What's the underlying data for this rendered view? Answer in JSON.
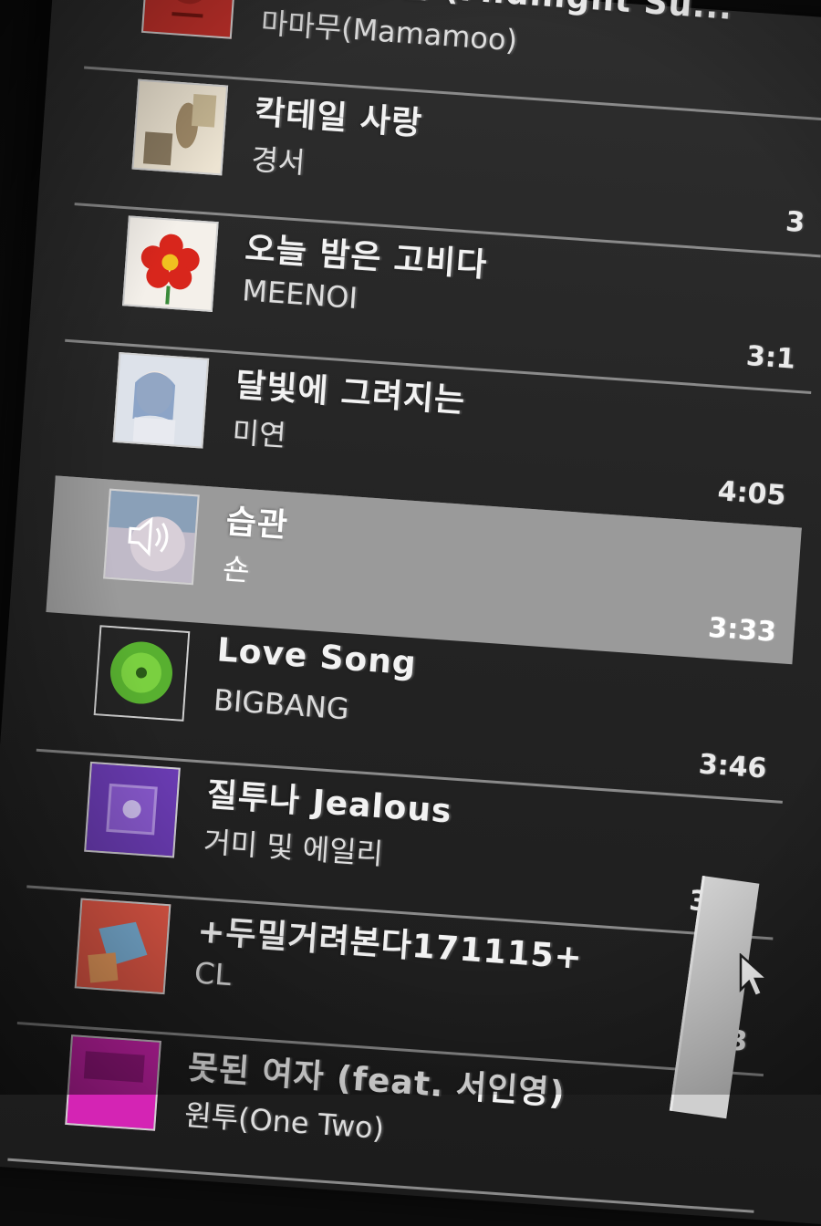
{
  "playlist": {
    "tracks": [
      {
        "title": "여름밤의 꿈 (Midnight Su...",
        "artist": "마마무(Mamamoo)",
        "duration": "",
        "active": false,
        "art": "red-square-art"
      },
      {
        "title": "칵테일 사랑",
        "artist": "경서",
        "duration": "3",
        "active": false,
        "art": "figure-photo-art"
      },
      {
        "title": "오늘 밤은 고비다",
        "artist": "MEENOI",
        "duration": "3:1",
        "active": false,
        "art": "red-flower-art"
      },
      {
        "title": "달빛에 그려지는",
        "artist": "미연",
        "duration": "4:05",
        "active": false,
        "art": "portrait-art"
      },
      {
        "title": "습관",
        "artist": "숀",
        "duration": "3:33",
        "active": true,
        "art": "now-playing-art"
      },
      {
        "title": "Love Song",
        "artist": "BIGBANG",
        "duration": "3:46",
        "active": false,
        "art": "green-disc-art"
      },
      {
        "title": "질투나 Jealous",
        "artist": "거미 및 에일리",
        "duration": "3:16",
        "active": false,
        "art": "purple-art"
      },
      {
        "title": "+두밀거려본다171115+",
        "artist": "CL",
        "duration": "3:13",
        "active": false,
        "art": "collage-art"
      },
      {
        "title": "못된 여자 (feat. 서인영)",
        "artist": "원투(One Two)",
        "duration": "",
        "active": false,
        "art": "magenta-art"
      }
    ]
  },
  "colors": {
    "active_row": "#9a9a9a",
    "background": "#252525",
    "text": "#f2f2f2"
  },
  "icons": {
    "now_playing": "speaker-icon",
    "pointer": "mouse-cursor-icon"
  }
}
